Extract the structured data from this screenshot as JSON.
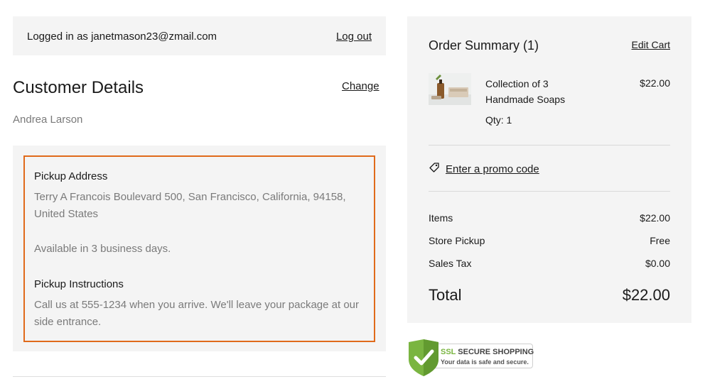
{
  "account": {
    "logged_in_text": "Logged in as janetmason23@zmail.com",
    "logout_label": "Log out"
  },
  "customer": {
    "title": "Customer Details",
    "change_label": "Change",
    "name": "Andrea Larson"
  },
  "pickup": {
    "address_heading": "Pickup Address",
    "address_text": "Terry A Francois Boulevard 500, San Francisco, California, 94158, United States",
    "availability_text": "Available in 3 business days.",
    "instructions_heading": "Pickup Instructions",
    "instructions_text": "Call us at 555-1234 when you arrive. We'll leave your package at our side entrance.",
    "highlight_color": "#e06a1b"
  },
  "summary": {
    "title": "Order Summary (1)",
    "edit_cart_label": "Edit Cart",
    "item": {
      "name": "Collection of 3 Handmade Soaps",
      "price": "$22.00",
      "qty": "Qty: 1",
      "thumbnail_icon": "soap-product-image"
    },
    "promo": {
      "icon": "tag-icon",
      "label": "Enter a promo code"
    },
    "rows": [
      {
        "label": "Items",
        "value": "$22.00"
      },
      {
        "label": "Store Pickup",
        "value": "Free"
      },
      {
        "label": "Sales Tax",
        "value": "$0.00"
      }
    ],
    "total": {
      "label": "Total",
      "value": "$22.00"
    }
  },
  "ssl": {
    "icon": "shield-check-icon",
    "badge_prefix": "SSL",
    "badge_suffix": "SECURE SHOPPING",
    "tagline": "Your data is safe and secure.",
    "shield_color": "#7ab541"
  }
}
